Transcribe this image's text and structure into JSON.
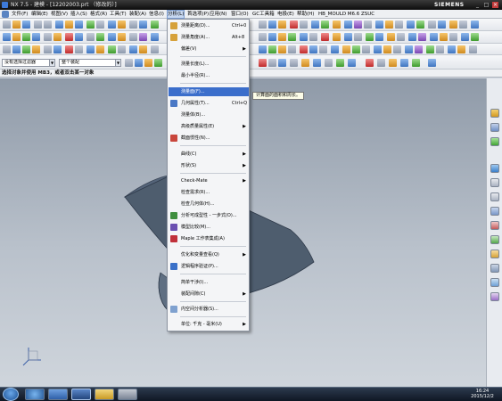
{
  "window": {
    "title": "NX 7.5 - 建模 - [12202003.prt （修改的）]",
    "brand": "SIEMENS",
    "controls": {
      "minimize": "_",
      "maximize": "□",
      "close": "×"
    }
  },
  "menubar": {
    "items": [
      "文件(F)",
      "编辑(E)",
      "视图(V)",
      "插入(S)",
      "格式(R)",
      "工具(T)",
      "装配(A)",
      "信息(I)",
      "分析(L)",
      "首选项(P)",
      "应用(N)",
      "窗口(O)",
      "GC工具箱",
      "电极(E)",
      "帮助(H)",
      "HB_MOULD M6.6",
      "ZSUC"
    ],
    "active_index": 8
  },
  "toolbar": {
    "selection_filter": "没有选择过滤器",
    "assembly_scope": "整个装配",
    "cue_line": "选择对象并使用 MB3，或者双击某一对象"
  },
  "analysis_menu": {
    "items": [
      {
        "label": "测量距离(D)...",
        "shortcut": "Ctrl+0",
        "icon": "ruler-icon",
        "icon_color": "#d6a13a"
      },
      {
        "label": "测量角度(A)...",
        "shortcut": "Alt+8",
        "icon": "angle-icon",
        "icon_color": "#d6a13a"
      },
      {
        "label": "偏差(V)",
        "submenu": true,
        "separator_after": true
      },
      {
        "label": "测量长度(L)..."
      },
      {
        "label": "最小半径(R)...",
        "separator_after": true
      },
      {
        "label": "测量面(F)...",
        "highlighted": true
      },
      {
        "label": "几何属性(T)...",
        "shortcut": "Ctrl+Q",
        "icon": "geometry-icon",
        "icon_color": "#4a78c5"
      },
      {
        "label": "测量体(B)..."
      },
      {
        "label": "高级质量属性(E)",
        "submenu": true
      },
      {
        "label": "截面惯性(N)...",
        "icon": "section-icon",
        "icon_color": "#c9463c",
        "separator_after": true
      },
      {
        "label": "曲线(C)",
        "submenu": true
      },
      {
        "label": "形状(S)",
        "submenu": true,
        "separator_after": true
      },
      {
        "label": "Check-Mate",
        "submenu": true
      },
      {
        "label": "检查需求(R)..."
      },
      {
        "label": "检查几何体(H)..."
      },
      {
        "label": "分析可成型性 - 一步式(O)...",
        "icon": "formability-icon",
        "icon_color": "#3f8f3f"
      },
      {
        "label": "模型比较(M)...",
        "icon": "compare-icon",
        "icon_color": "#6a4fb0"
      },
      {
        "label": "Maple 工作表集成(A)",
        "icon": "maple-icon",
        "icon_color": "#c0303a",
        "separator_after": true
      },
      {
        "label": "优化和变量查看(Q)",
        "submenu": true
      },
      {
        "label": "逻辑程序验证(P)...",
        "icon": "logic-icon",
        "icon_color": "#3a70c8",
        "separator_after": true
      },
      {
        "label": "简单干涉(I)..."
      },
      {
        "label": "装配间隙(C)",
        "submenu": true,
        "separator_after": true
      },
      {
        "label": "内空间分析器(S)...",
        "icon": "space-analyzer-icon",
        "icon_color": "#7fa1cf",
        "separator_after": true
      },
      {
        "label": "单位: 千克 - 毫米(U)",
        "submenu": true
      }
    ]
  },
  "tooltip": "计算面的面积和周长。",
  "viewport": {
    "background_top": "#8f9aa8",
    "background_bottom": "#cfd5dc",
    "part_color": "#4e5d6e"
  },
  "taskbar": {
    "time": "16:24",
    "date": "2015/12/2"
  }
}
